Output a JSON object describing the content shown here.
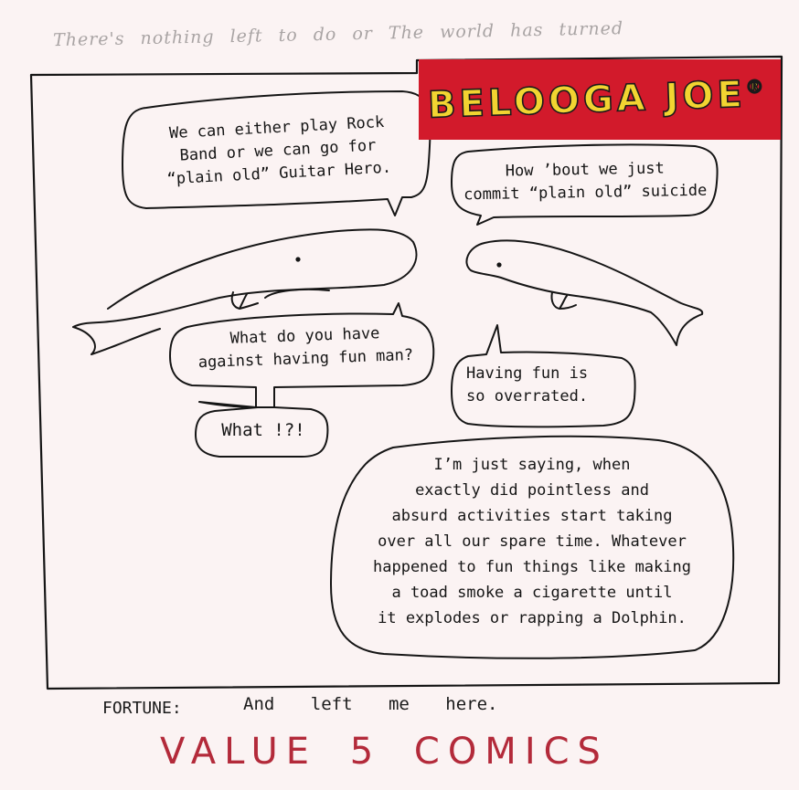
{
  "comic": {
    "top_note": "There's nothing left to do or The world has turned",
    "title": "BELOOGA JOE",
    "title_mark": "®",
    "colors": {
      "paper": "#fbf3f3",
      "title_banner": "#d21a2b",
      "title_letters": "#f2d431",
      "ink": "#151515",
      "publisher_ink": "#b32a3a"
    },
    "bubbles": [
      {
        "speaker": "whale-left",
        "text": "We can either play Rock\nBand or we can go for\n“plain old” Guitar Hero."
      },
      {
        "speaker": "whale-right",
        "text": "How ’bout we just\ncommit “plain old” suicide"
      },
      {
        "speaker": "whale-left",
        "text": "What do you have\nagainst having fun man?"
      },
      {
        "speaker": "whale-left",
        "text": "What !?!"
      },
      {
        "speaker": "whale-right",
        "text": "Having fun is\nso overrated."
      },
      {
        "speaker": "whale-right",
        "text": "I’m just saying, when\nexactly did pointless and\nabsurd activities start taking\nover all our spare time. Whatever\nhappened to fun things like making\na toad smoke a cigarette until\nit explodes or rapping a Dolphin."
      }
    ],
    "fortune_label": "FORTUNE:",
    "fortune_text": "And left me here.",
    "publisher": "VALUE 5 COMICS"
  }
}
